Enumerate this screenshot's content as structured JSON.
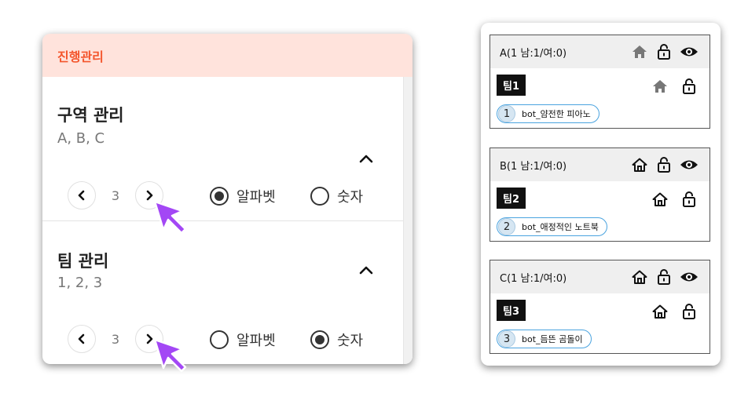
{
  "progress_panel": {
    "header_title": "진행관리",
    "zone_section": {
      "title": "구역 관리",
      "subtitle": "A, B, C",
      "step_value": "3",
      "options": [
        "알파벳",
        "숫자"
      ],
      "selected": "알파벳"
    },
    "team_section": {
      "title": "팀 관리",
      "subtitle": "1, 2, 3",
      "step_value": "3",
      "options": [
        "알파벳",
        "숫자"
      ],
      "selected": "숫자"
    }
  },
  "zones": [
    {
      "title": "A(1 남:1/여:0)",
      "team": "팀1",
      "member_no": "1",
      "member_name": "bot_얌전한 피아노",
      "home_style": "filled"
    },
    {
      "title": "B(1 남:1/여:0)",
      "team": "팀2",
      "member_no": "2",
      "member_name": "bot_애정적인 노트북",
      "home_style": "outline"
    },
    {
      "title": "C(1 남:1/여:0)",
      "team": "팀3",
      "member_no": "3",
      "member_name": "bot_듬뜬 곰돌이",
      "home_style": "outline"
    }
  ],
  "colors": {
    "header_bg": "#ffe3dc",
    "header_text": "#f4562d",
    "cursor": "#a347f5",
    "member_border": "#4aa3df"
  }
}
